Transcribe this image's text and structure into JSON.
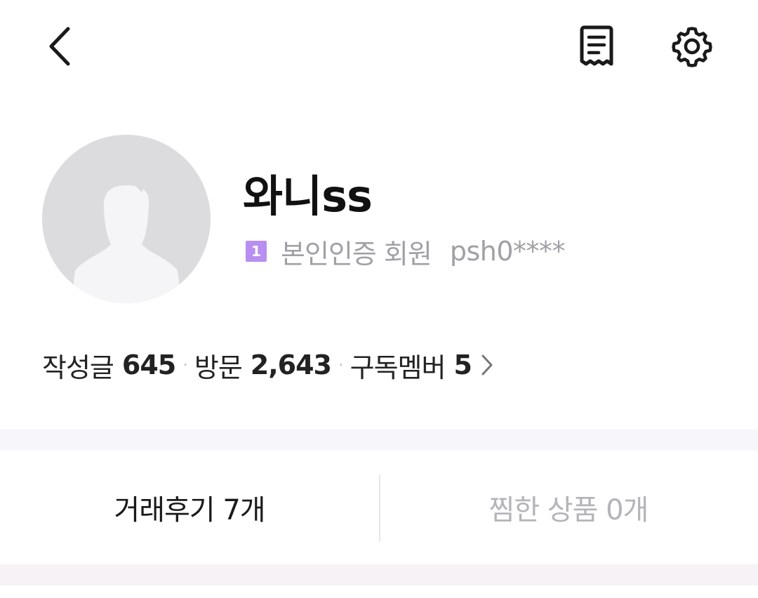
{
  "topbar": {
    "back_icon": "chevron-left-icon",
    "receipt_icon": "receipt-icon",
    "settings_icon": "gear-icon"
  },
  "profile": {
    "avatar_icon": "default-avatar-icon",
    "nickname": "와니ss",
    "level_badge": "1",
    "verify_text": "본인인증 회원",
    "user_id": "psh0****",
    "badge_color": "#b88ef1"
  },
  "stats": {
    "posts_label": "작성글",
    "posts_value": "645",
    "visits_label": "방문",
    "visits_value": "2,643",
    "subscribers_label": "구독멤버",
    "subscribers_value": "5",
    "separator": "·",
    "chevron_icon": "chevron-right-icon"
  },
  "tabs": {
    "reviews_label": "거래후기 7개",
    "liked_label": "찜한 상품 0개"
  }
}
